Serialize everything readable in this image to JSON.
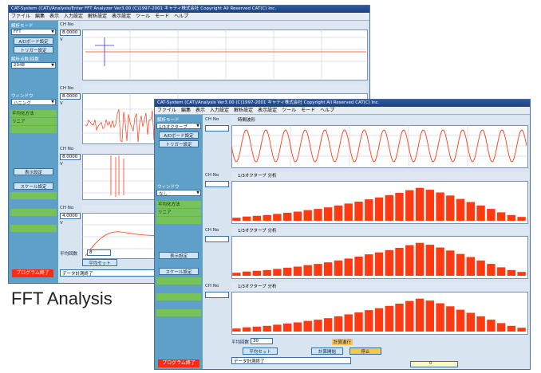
{
  "caption": "FFT Analysis",
  "back_window": {
    "title": "CAT-System (CAT)/Analysis/Enter FFT Analyzer  Ver3.00  (C)1997-2001 キャティ株式会社  Copyright All Reserved CAT(C) Inc.",
    "menu": [
      "ファイル",
      "編集",
      "表示",
      "入力設定",
      "解析設定",
      "表示設定",
      "ツール",
      "モード",
      "ヘルプ"
    ],
    "side": {
      "mode_label": "解析モード",
      "mode_value": "FFT",
      "ad_button": "A/Dボード設定",
      "trigger_button": "トリガー設定",
      "samples_label": "解析点数/回数",
      "samples_value": "2048",
      "window_label": "ウィンドウ",
      "window_value": "ハニング",
      "avg_label": "平均化方法",
      "avg_value": "リニア",
      "display_button": "表示設定",
      "scale_button": "スケール設定",
      "status_button": "プログラム終了"
    },
    "channels": [
      {
        "ch": "CH No",
        "val": "1",
        "range": "8.0000",
        "unit": "V",
        "header": "時間波形"
      },
      {
        "ch": "CH No",
        "val": "2",
        "range": "8.0000",
        "unit": "V",
        "header": "時間波形"
      },
      {
        "ch": "CH No",
        "val": "3",
        "range": "8.0000",
        "unit": "V",
        "header": "伝達関数"
      },
      {
        "ch": "CH No",
        "val": "4",
        "range": "4.0000",
        "unit": "V",
        "header": "伝達関数"
      }
    ],
    "footer": {
      "avg_count_label": "平均回数",
      "avg_count_value": "8",
      "start_button": "平均セット",
      "message": "データ計測終了"
    }
  },
  "front_window": {
    "title": "CAT-System (CAT)/Analysis  Ver3.00  (C)1997-2001 キャティ株式会社  Copyright All Reserved CAT(C) Inc.",
    "menu": [
      "ファイル",
      "編集",
      "表示",
      "入力設定",
      "解析設定",
      "表示設定",
      "ツール",
      "モード",
      "ヘルプ"
    ],
    "side": {
      "mode_label": "解析モード",
      "mode_value": "1/3オクターブ",
      "ad_button": "A/Dボード設定",
      "trigger_button": "トリガー設定",
      "window_label": "ウィンドウ",
      "window_value": "なし",
      "avg_label": "平均化方法",
      "avg_value": "リニア",
      "display_button": "表示設定",
      "scale_button": "スケール設定",
      "status_button": "プログラム終了"
    },
    "panels": [
      {
        "header": "時間波形",
        "type": "time"
      },
      {
        "header": "1/3オクターブ 分析",
        "type": "bars"
      },
      {
        "header": "1/3オクターブ 分析",
        "type": "bars"
      },
      {
        "header": "1/3オクターブ 分析",
        "type": "bars"
      }
    ],
    "footer": {
      "avg_count_label": "平均回数",
      "avg_count_value": "30",
      "start_button": "平均セット",
      "calc_button": "計算開始",
      "stop_button": "停止",
      "message": "データ計測終了",
      "progress_label": "計算進行",
      "progress_value": "0"
    },
    "octave_values": [
      8,
      11,
      13,
      15,
      18,
      21,
      24,
      28,
      31,
      35,
      40,
      45,
      50,
      56,
      61,
      67,
      73,
      80,
      86,
      81,
      74,
      66,
      57,
      49,
      40,
      31,
      22,
      15,
      10
    ]
  },
  "colors": {
    "accent": "#5fa0c8",
    "signal": "#ff3a12",
    "window_bg": "#d8e4f0"
  }
}
